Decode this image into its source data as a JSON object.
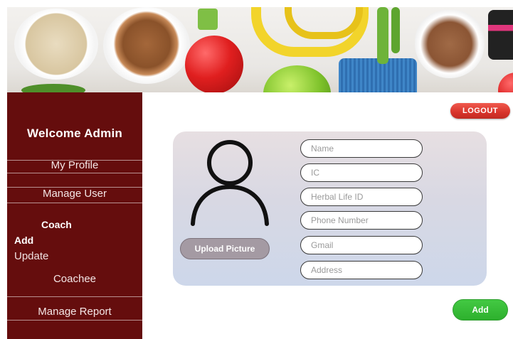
{
  "sidebar": {
    "welcome": "Welcome Admin",
    "items": [
      {
        "label": "My Profile"
      },
      {
        "label": "Manage User"
      },
      {
        "label": "Coach"
      },
      {
        "label": "Add"
      },
      {
        "label": "Update"
      },
      {
        "label": "Coachee"
      },
      {
        "label": "Manage Report"
      }
    ]
  },
  "header": {
    "logout_label": "LOGOUT"
  },
  "form": {
    "upload_label": "Upload Picture",
    "fields": [
      {
        "placeholder": "Name"
      },
      {
        "placeholder": "IC"
      },
      {
        "placeholder": "Herbal Life ID"
      },
      {
        "placeholder": "Phone Number"
      },
      {
        "placeholder": "Gmail"
      },
      {
        "placeholder": "Address"
      }
    ],
    "submit_label": "Add"
  },
  "colors": {
    "sidebar_bg": "#650d0d",
    "logout_bg": "#d8342b",
    "add_bg": "#2db02d",
    "card_bg": "#d8d8e3"
  },
  "icons": [
    "user-avatar-icon"
  ]
}
